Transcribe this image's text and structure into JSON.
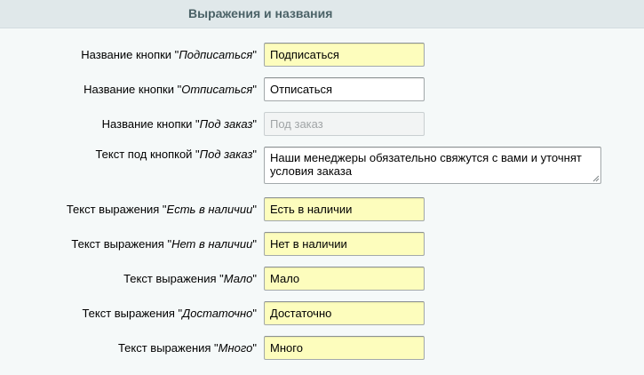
{
  "section": {
    "title": "Выражения и названия"
  },
  "rows": [
    {
      "label_prefix": "Название кнопки \"",
      "label_italic": "Подписаться",
      "label_suffix": "\"",
      "value": "Подписаться",
      "placeholder": ""
    },
    {
      "label_prefix": "Название кнопки \"",
      "label_italic": "Отписаться",
      "label_suffix": "\"",
      "value": "Отписаться",
      "placeholder": ""
    },
    {
      "label_prefix": "Название кнопки \"",
      "label_italic": "Под заказ",
      "label_suffix": "\"",
      "value": "",
      "placeholder": "Под заказ"
    },
    {
      "label_prefix": "Текст под кнопкой \"",
      "label_italic": "Под заказ",
      "label_suffix": "\"",
      "value": "Наши менеджеры обязательно свяжутся с вами и уточнят условия заказа",
      "placeholder": ""
    },
    {
      "label_prefix": "Текст выражения \"",
      "label_italic": "Есть в наличии",
      "label_suffix": "\"",
      "value": "Есть в наличии",
      "placeholder": ""
    },
    {
      "label_prefix": "Текст выражения \"",
      "label_italic": "Нет в наличии",
      "label_suffix": "\"",
      "value": "Нет в наличии",
      "placeholder": ""
    },
    {
      "label_prefix": "Текст выражения \"",
      "label_italic": "Мало",
      "label_suffix": "\"",
      "value": "Мало",
      "placeholder": ""
    },
    {
      "label_prefix": "Текст выражения \"",
      "label_italic": "Достаточно",
      "label_suffix": "\"",
      "value": "Достаточно",
      "placeholder": ""
    },
    {
      "label_prefix": "Текст выражения \"",
      "label_italic": "Много",
      "label_suffix": "\"",
      "value": "Много",
      "placeholder": ""
    }
  ],
  "colors": {
    "header_bg": "#e0e8ea",
    "header_text": "#4b6267",
    "page_bg": "#f5f9f9",
    "field_autofill": "#fdfdbd",
    "field_white": "#ffffff"
  }
}
